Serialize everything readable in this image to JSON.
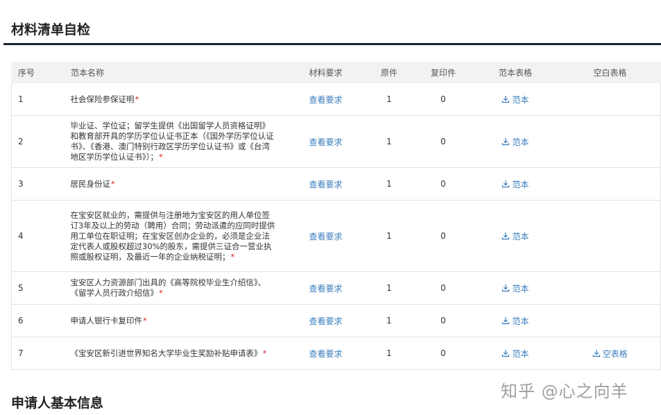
{
  "section1": {
    "title": "材料清单自检"
  },
  "section2": {
    "title": "申请人基本信息"
  },
  "table": {
    "headers": {
      "index": "序号",
      "name": "范本名称",
      "requirement": "材料要求",
      "original": "原件",
      "copy": "复印件",
      "sample": "范本表格",
      "blank": "空白表格"
    },
    "rows": [
      {
        "index": "1",
        "name": "社会保险参保证明",
        "required_mark": "*",
        "requirement": "查看要求",
        "original": "1",
        "copy": "0",
        "sample": "范本",
        "blank": ""
      },
      {
        "index": "2",
        "name": "毕业证、学位证；留学生提供《出国留学人员资格证明》和教育部开具的学历学位认证书正本（《国外学历学位认证书》、《香港、澳门特别行政区学历学位认证书》或《台湾地区学历学位认证书》）；",
        "required_mark": "*",
        "requirement": "查看要求",
        "original": "1",
        "copy": "0",
        "sample": "范本",
        "blank": ""
      },
      {
        "index": "3",
        "name": "居民身份证",
        "required_mark": "*",
        "requirement": "查看要求",
        "original": "1",
        "copy": "0",
        "sample": "范本",
        "blank": ""
      },
      {
        "index": "4",
        "name": "在宝安区就业的，需提供与注册地为宝安区的用人单位签订3年及以上的劳动（聘用）合同；劳动派遣的应同时提供用工单位在职证明；在宝安区创办企业的，必须是企业法定代表人或股权超过30%的股东，需提供三证合一营业执照或股权证明，及最近一年的企业纳税证明；",
        "required_mark": "*",
        "requirement": "查看要求",
        "original": "1",
        "copy": "0",
        "sample": "范本",
        "blank": ""
      },
      {
        "index": "5",
        "name": "宝安区人力资源部门出具的《高等院校毕业生介绍信》、《留学人员行政介绍信》",
        "required_mark": "*",
        "requirement": "查看要求",
        "original": "1",
        "copy": "0",
        "sample": "范本",
        "blank": ""
      },
      {
        "index": "6",
        "name": "申请人银行卡复印件",
        "required_mark": "*",
        "requirement": "查看要求",
        "original": "1",
        "copy": "0",
        "sample": "范本",
        "blank": ""
      },
      {
        "index": "7",
        "name": "《宝安区新引进世界知名大学毕业生奖励补贴申请表》",
        "required_mark": "*",
        "requirement": "查看要求",
        "original": "1",
        "copy": "0",
        "sample": "范本",
        "blank": "空表格"
      }
    ]
  },
  "watermark": {
    "text": "知乎 @心之向羊"
  },
  "colors": {
    "link": "#3a7dbd",
    "required": "#d9272e",
    "rule": "#1b2230",
    "header_bg": "#f2f2f2"
  },
  "icons": {
    "download": "download-icon"
  }
}
